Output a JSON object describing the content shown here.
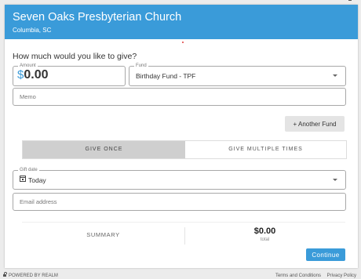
{
  "church": {
    "name": "Seven Oaks Presbyterian Church",
    "location": "Columbia, SC"
  },
  "form": {
    "question": "How much would you like to give?",
    "amount": {
      "label": "Amount",
      "currency": "$",
      "value": "0.00"
    },
    "fund": {
      "label": "Fund",
      "value": "Birthday Fund - TPF"
    },
    "memo": {
      "placeholder": "Memo"
    },
    "another_fund_label": "+ Another Fund",
    "frequency": {
      "selected": "GIVE ONCE",
      "options": [
        "GIVE ONCE",
        "GIVE MULTIPLE TIMES"
      ]
    },
    "gift_date": {
      "label": "Gift date",
      "value": "Today"
    },
    "email": {
      "placeholder": "Email address"
    }
  },
  "summary": {
    "label": "SUMMARY",
    "total": "$0.00",
    "total_label": "total"
  },
  "continue_label": "Continue",
  "footer": {
    "powered": "POWERED BY REALM",
    "terms": "Terms and Conditions",
    "privacy": "Privacy Policy"
  },
  "colors": {
    "accent": "#3a9bd9",
    "selected_tab": "#cfcfcf"
  }
}
